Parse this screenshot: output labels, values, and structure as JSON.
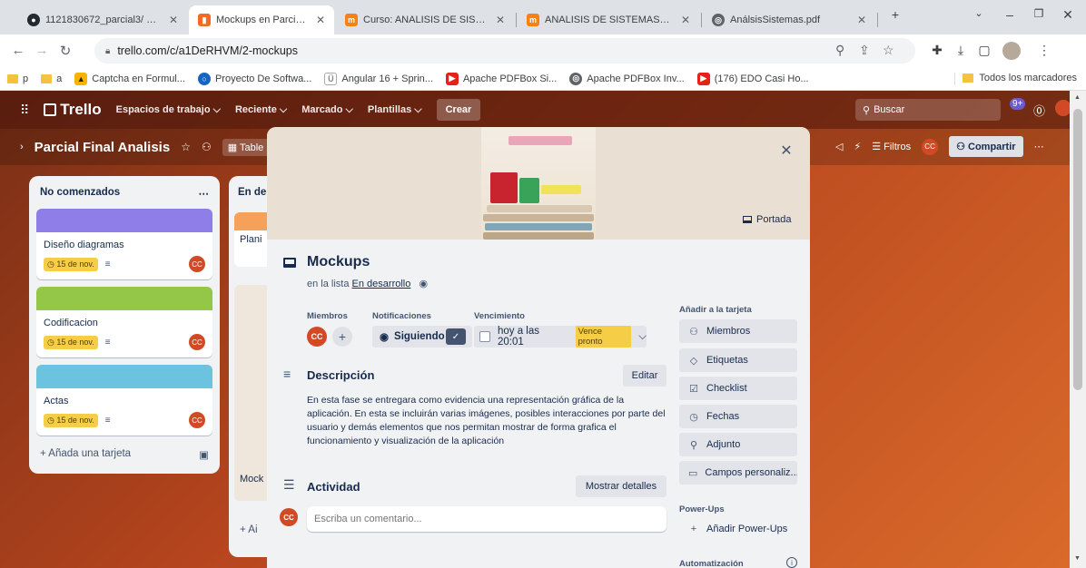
{
  "browser": {
    "tabs": [
      {
        "title": "1121830672_parcial3/ at ma",
        "icon": "github-icon",
        "active": false
      },
      {
        "title": "Mockups en Parcial Final An",
        "icon": "trello-icon",
        "active": true
      },
      {
        "title": "Curso: ANALISIS DE SISTEMA",
        "icon": "moodle-icon",
        "active": false
      },
      {
        "title": "ANALISIS DE SISTEMAS [G1]",
        "icon": "moodle-icon",
        "active": false
      },
      {
        "title": "AnálsisSistemas.pdf",
        "icon": "globe-icon",
        "active": false
      }
    ],
    "url": "trello.com/c/a1DeRHVM/2-mockups",
    "bookmarks": [
      "p",
      "a",
      "Captcha en Formul...",
      "Proyecto De Softwa...",
      "Angular 16 + Sprin...",
      "Apache PDFBox Si...",
      "Apache PDFBox Inv...",
      "(176) EDO Casi Ho..."
    ],
    "all_bookmarks": "Todos los marcadores"
  },
  "trello": {
    "logo": "Trello",
    "menu": [
      "Espacios de trabajo",
      "Reciente",
      "Marcado",
      "Plantillas"
    ],
    "create": "Crear",
    "search_placeholder": "Buscar",
    "notif_count": "9+",
    "user_initials": "CC",
    "board_name": "Parcial Final Analisis",
    "board_view": "Table",
    "filters": "Filtros",
    "share": "Compartir"
  },
  "list1": {
    "title": "No comenzados",
    "cards": [
      {
        "title": "Diseño diagramas",
        "due": "15 de nov.",
        "cover": "#8f7ee7"
      },
      {
        "title": "Codificacion",
        "due": "15 de nov.",
        "cover": "#94c748"
      },
      {
        "title": "Actas",
        "due": "15 de nov.",
        "cover": "#6cc3e0"
      }
    ],
    "add_card": "Añada una tarjeta"
  },
  "list2": {
    "title": "En de",
    "card1": "Plani",
    "card2": "Mock",
    "add": "+ Ai"
  },
  "modal": {
    "cover_label": "Portada",
    "title": "Mockups",
    "in_list_prefix": "en la lista",
    "in_list_name": "En desarrollo",
    "members_label": "Miembros",
    "notifications_label": "Notificaciones",
    "due_label": "Vencimiento",
    "member_initials": "CC",
    "follow_label": "Siguiendo",
    "due_value": "hoy a las 20:01",
    "due_badge": "Vence pronto",
    "description_title": "Descripción",
    "edit_label": "Editar",
    "description": "En esta fase se entregara como evidencia una representación gráfica de la aplicación. En esta se incluirán varias imágenes, posibles interacciones por parte del usuario y demás elementos que nos permitan mostrar de forma grafica el funcionamiento y visualización de la aplicación",
    "activity_title": "Actividad",
    "show_details": "Mostrar detalles",
    "comment_placeholder": "Escriba un comentario...",
    "add_to_card_label": "Añadir a la tarjeta",
    "side_buttons": [
      "Miembros",
      "Etiquetas",
      "Checklist",
      "Fechas",
      "Adjunto",
      "Campos personaliz..."
    ],
    "powerups_label": "Power-Ups",
    "add_powerups": "Añadir Power-Ups",
    "automation_label": "Automatización"
  }
}
